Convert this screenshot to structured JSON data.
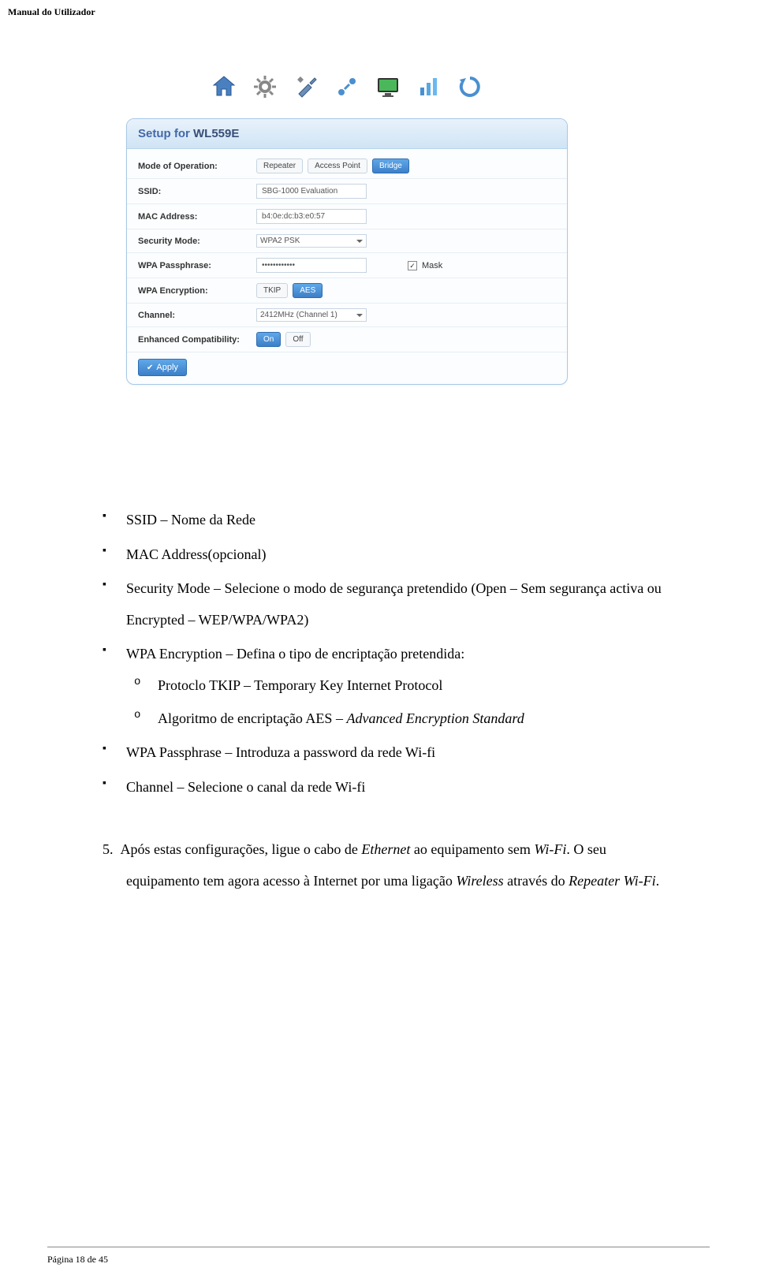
{
  "header": "Manual do Utilizador",
  "footer": "Página 18 de 45",
  "panel": {
    "title_prefix": "Setup for ",
    "title_model": "WL559E",
    "rows": {
      "mode_label": "Mode of Operation:",
      "mode_opts": [
        "Repeater",
        "Access Point",
        "Bridge"
      ],
      "ssid_label": "SSID:",
      "ssid_value": "SBG-1000 Evaluation",
      "mac_label": "MAC Address:",
      "mac_value": "b4:0e:dc:b3:e0:57",
      "sec_label": "Security Mode:",
      "sec_value": "WPA2 PSK",
      "pass_label": "WPA Passphrase:",
      "pass_value": "••••••••••••",
      "mask_label": "Mask",
      "enc_label": "WPA Encryption:",
      "enc_opts": [
        "TKIP",
        "AES"
      ],
      "chan_label": "Channel:",
      "chan_value": "2412MHz (Channel 1)",
      "compat_label": "Enhanced Compatibility:",
      "compat_opts": [
        "On",
        "Off"
      ]
    },
    "apply": "Apply"
  },
  "bullets": {
    "ssid": "SSID – Nome da Rede",
    "mac": "MAC Address(opcional)",
    "sec_prefix": "Security Mode – Selecione o modo de segurança pretendido (Open – Sem segurança activa ou Encrypted – WEP/WPA/WPA2)",
    "enc_prefix": "WPA Encryption – Defina o tipo de encriptação pretendida:",
    "sub_tkip": "Protoclo TKIP – Temporary Key Internet Protocol",
    "sub_aes_prefix": "Algoritmo de encriptação AES – ",
    "sub_aes_em": "Advanced Encryption Standard",
    "pass": "WPA Passphrase – Introduza a password da rede Wi-fi",
    "chan": "Channel – Selecione o canal da rede Wi-fi"
  },
  "step5": {
    "num": "5.",
    "text_a": "Após estas configurações, ligue o cabo de ",
    "em1": "Ethernet",
    "text_b": " ao equipamento sem ",
    "em2": "Wi-Fi",
    "text_c": ". O seu equipamento tem agora acesso à Internet por uma ligação ",
    "em3": "Wireless",
    "text_d": " através do ",
    "em4": "Repeater Wi-Fi",
    "text_e": "."
  }
}
